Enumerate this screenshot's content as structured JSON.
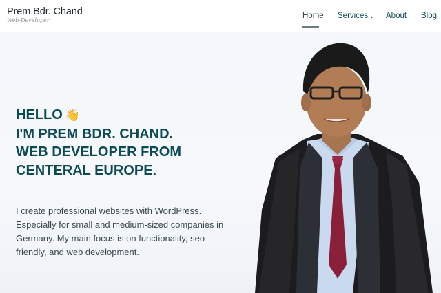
{
  "logo": {
    "name": "Prem Bdr. Chand",
    "tagline": "Web-Developer"
  },
  "nav": {
    "home": "Home",
    "services": "Services",
    "about": "About",
    "blog": "Blog"
  },
  "hero": {
    "greeting": "HELLO",
    "wave": "👋",
    "line2": "I'M PREM BDR. CHAND.",
    "line3": "WEB DEVELOPER FROM",
    "line4": "CENTERAL EUROPE.",
    "description": "I create professional websites with WordPress. Especially for small and medium-sized companies in Germany. My main focus is on functionality, seo-friendly, and web development."
  },
  "colors": {
    "accent": "#0c4a55",
    "text": "#3a4a50",
    "background": "#f4f7fb"
  }
}
